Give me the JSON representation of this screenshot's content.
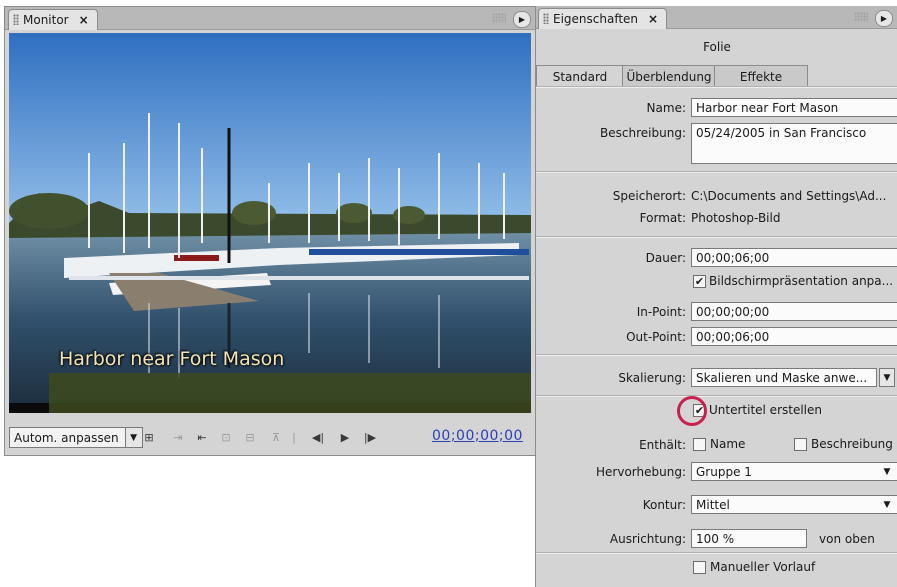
{
  "monitor": {
    "tab_label": "Monitor",
    "caption": "Harbor near Fort Mason",
    "fit_label": "Autom. anpassen",
    "timecode": "00;00;00;00"
  },
  "properties": {
    "tab_label": "Eigenschaften",
    "header": "Folie",
    "tabs": [
      "Standard",
      "Überblendung",
      "Effekte"
    ],
    "name_label": "Name:",
    "name_value": "Harbor near Fort Mason",
    "desc_label": "Beschreibung:",
    "desc_value": "05/24/2005 in San Francisco",
    "location_label": "Speicherort:",
    "location_value": "C:\\Documents and Settings\\Ad...",
    "format_label": "Format:",
    "format_value": "Photoshop-Bild",
    "duration_label": "Dauer:",
    "duration_value": "00;00;06;00",
    "adapt_checkbox": "Bildschirmpräsentation anpa...",
    "inpoint_label": "In-Point:",
    "inpoint_value": "00;00;00;00",
    "outpoint_label": "Out-Point:",
    "outpoint_value": "00;00;06;00",
    "scaling_label": "Skalierung:",
    "scaling_value": "Skalieren und Maske anwe...",
    "subtitle_checkbox": "Untertitel erstellen",
    "contains_label": "Enthält:",
    "contains_name": "Name",
    "contains_desc": "Beschreibung",
    "emphasis_label": "Hervorhebung:",
    "emphasis_value": "Gruppe 1",
    "outline_label": "Kontur:",
    "outline_value": "Mittel",
    "alignment_label": "Ausrichtung:",
    "alignment_value": "100 %",
    "alignment_suffix": "von oben",
    "manual_checkbox": "Manueller Vorlauf"
  },
  "colors": {
    "highlight": "#c8204d",
    "timecode": "#2a3fb8"
  }
}
